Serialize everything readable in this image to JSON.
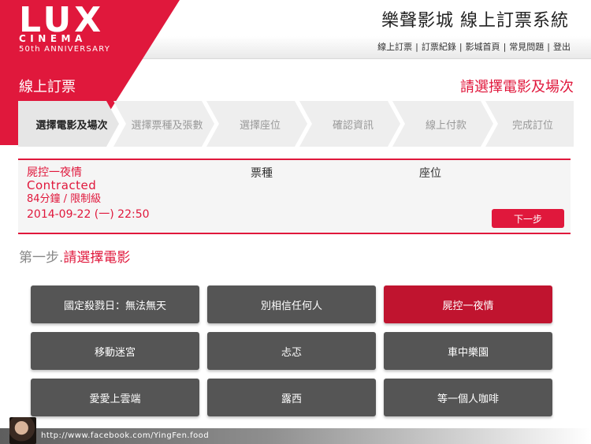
{
  "header": {
    "logo": {
      "brand": "LUX",
      "sub": "CINEMA",
      "anniversary": "50th ANNIVERSARY"
    },
    "system_title": "樂聲影城 線上訂票系統",
    "nav_links": [
      "線上訂票",
      "訂票紀錄",
      "影城首頁",
      "常見問題",
      "登出"
    ]
  },
  "section": {
    "heading": "線上訂票",
    "prompt": "請選擇電影及場次"
  },
  "steps": [
    {
      "label": "選擇電影及場次",
      "active": true
    },
    {
      "label": "選擇票種及張數",
      "active": false
    },
    {
      "label": "選擇座位",
      "active": false
    },
    {
      "label": "確認資訊",
      "active": false
    },
    {
      "label": "線上付款",
      "active": false
    },
    {
      "label": "完成訂位",
      "active": false
    }
  ],
  "booking": {
    "movie_zh": "屍控一夜情",
    "movie_en": "Contracted",
    "meta": "84分鐘 / 限制級",
    "showtime": "2014-09-22 (一) 22:50",
    "ticket_header": "票種",
    "seat_header": "座位",
    "next_label": "下一步"
  },
  "step_heading": {
    "prefix": "第一步.",
    "main": "請選擇電影"
  },
  "movies": [
    {
      "title": "國定殺戮日：無法無天",
      "selected": false
    },
    {
      "title": "別相信任何人",
      "selected": false
    },
    {
      "title": "屍控一夜情",
      "selected": true
    },
    {
      "title": "移動迷宮",
      "selected": false
    },
    {
      "title": "忐忑",
      "selected": false
    },
    {
      "title": "車中樂園",
      "selected": false
    },
    {
      "title": "愛愛上雲端",
      "selected": false
    },
    {
      "title": "露西",
      "selected": false
    },
    {
      "title": "等一個人咖啡",
      "selected": false
    }
  ],
  "footer": {
    "url": "http://www.facebook.com/YingFen.food"
  },
  "colors": {
    "accent": "#e0183c",
    "button": "#555555",
    "selected_button": "#c0142f"
  }
}
